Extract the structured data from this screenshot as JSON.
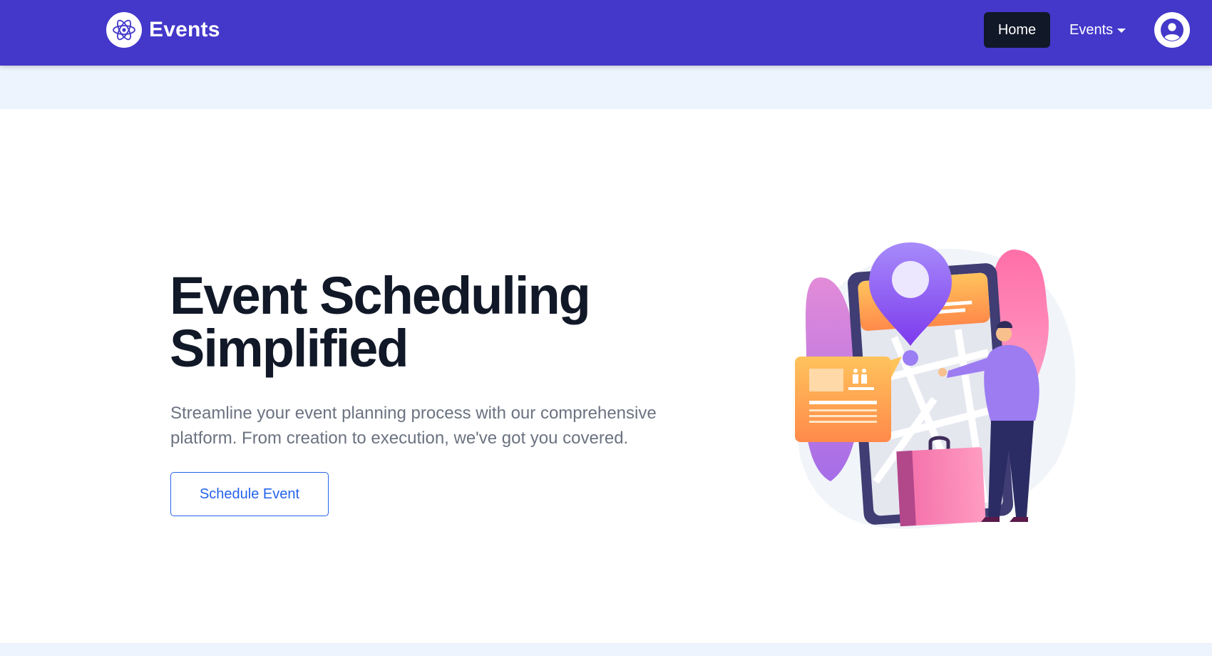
{
  "navbar": {
    "brand": {
      "name": "Events",
      "icon": "atom-icon"
    },
    "links": [
      {
        "label": "Home",
        "active": true
      },
      {
        "label": "Events",
        "has_dropdown": true,
        "icon": "caret-down-icon"
      }
    ],
    "profile_icon": "user-circle-icon"
  },
  "hero": {
    "title_line1": "Event Scheduling",
    "title_line2": "Simplified",
    "subtitle": "Streamline your event planning process with our comprehensive platform. From creation to execution, we've got you covered.",
    "cta_label": "Schedule Event",
    "illustration": "map-navigation-illustration"
  },
  "colors": {
    "navbar_bg": "#4338ca",
    "active_link_bg": "#111827",
    "band_bg": "#eef4fd",
    "title": "#111827",
    "subtitle": "#6b7280",
    "cta_accent": "#2563eb"
  }
}
